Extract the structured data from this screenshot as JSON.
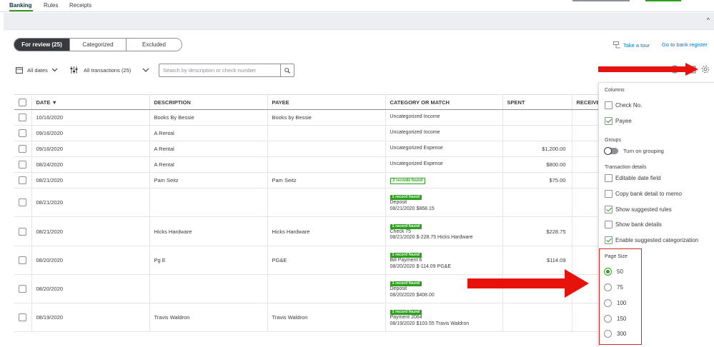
{
  "top_tabs": [
    "Banking",
    "Rules",
    "Receipts"
  ],
  "segments": [
    {
      "label": "For review (25)",
      "active": true
    },
    {
      "label": "Categorized",
      "active": false
    },
    {
      "label": "Excluded",
      "active": false
    }
  ],
  "links": {
    "tour": "Take a tour",
    "bank_register": "Go to bank register"
  },
  "filters": {
    "dates": "All dates",
    "transactions": "All transactions (25)"
  },
  "search": {
    "placeholder": "Search by description or check number"
  },
  "table": {
    "headers": [
      "DATE ▼",
      "DESCRIPTION",
      "PAYEE",
      "CATEGORY OR MATCH",
      "SPENT",
      "RECEIVED"
    ],
    "rows": [
      {
        "date": "10/16/2020",
        "description": "Books By Bessie",
        "payee": "Books by Bessie",
        "badge": "",
        "category": [
          "Uncategorized Income"
        ],
        "spent": ""
      },
      {
        "date": "09/16/2020",
        "description": "A Rental",
        "payee": "",
        "badge": "",
        "category": [
          "Uncategorized Income"
        ],
        "spent": ""
      },
      {
        "date": "09/16/2020",
        "description": "A Rental",
        "payee": "",
        "badge": "",
        "category": [
          "Uncategorized Expense"
        ],
        "spent": "$1,200.00"
      },
      {
        "date": "08/24/2020",
        "description": "A Rental",
        "payee": "",
        "badge": "",
        "category": [
          "Uncategorized Expense"
        ],
        "spent": "$800.00"
      },
      {
        "date": "08/21/2020",
        "description": "Pam Seitz",
        "payee": "Pam Seitz",
        "badge": "2 records found",
        "badge_style": "outline",
        "category": [],
        "spent": "$75.00"
      },
      {
        "date": "08/21/2020",
        "description": "",
        "payee": "",
        "badge": "1 record found",
        "badge_style": "solid",
        "category": [
          "Deposit",
          "08/21/2020 $868.15"
        ],
        "spent": ""
      },
      {
        "date": "08/21/2020",
        "description": "Hicks Hardware",
        "payee": "Hicks Hardware",
        "badge": "1 record found",
        "badge_style": "solid",
        "category": [
          "Check 75",
          "08/21/2020 $-228.75 Hicks Hardware"
        ],
        "spent": "$228.75"
      },
      {
        "date": "08/20/2020",
        "description": "Pg E",
        "payee": "PG&E",
        "badge": "1 record found",
        "badge_style": "solid",
        "category": [
          "Bill Payment 6",
          "08/20/2020 $-114.09 PG&E"
        ],
        "spent": "$114.09"
      },
      {
        "date": "08/20/2020",
        "description": "",
        "payee": "",
        "badge": "1 record found",
        "badge_style": "solid",
        "category": [
          "Deposit",
          "08/20/2020 $408.00"
        ],
        "spent": ""
      },
      {
        "date": "08/19/2020",
        "description": "Travis Waldron",
        "payee": "Travis Waldron",
        "badge": "1 record found",
        "badge_style": "solid",
        "category": [
          "Payment 2064",
          "08/19/2020 $103.55 Travis Waldron"
        ],
        "spent": ""
      }
    ]
  },
  "settings_panel": {
    "columns_heading": "Columns",
    "columns": [
      {
        "label": "Check No.",
        "checked": false
      },
      {
        "label": "Payee",
        "checked": true
      }
    ],
    "groups_heading": "Groups",
    "grouping_label": "Turn on grouping",
    "transaction_heading": "Transaction details",
    "transaction_options": [
      {
        "label": "Editable date field",
        "checked": false
      },
      {
        "label": "Copy bank detail to memo",
        "checked": false
      },
      {
        "label": "Show suggested rules",
        "checked": true
      },
      {
        "label": "Show bank details",
        "checked": false
      },
      {
        "label": "Enable suggested categorization",
        "checked": true
      }
    ],
    "page_size_heading": "Page Size",
    "page_sizes": [
      {
        "label": "50",
        "selected": true
      },
      {
        "label": "75",
        "selected": false
      },
      {
        "label": "100",
        "selected": false
      },
      {
        "label": "150",
        "selected": false
      },
      {
        "label": "300",
        "selected": false
      }
    ]
  },
  "colors": {
    "accent_green": "#2ca01c",
    "annotation_red": "#e8120c",
    "link_blue": "#0077c5"
  },
  "icons": [
    "calendar-icon",
    "filter-icon",
    "chevron-down-icon",
    "search-icon",
    "tour-icon",
    "print-icon",
    "export-icon",
    "gear-icon",
    "caret-up-icon"
  ]
}
